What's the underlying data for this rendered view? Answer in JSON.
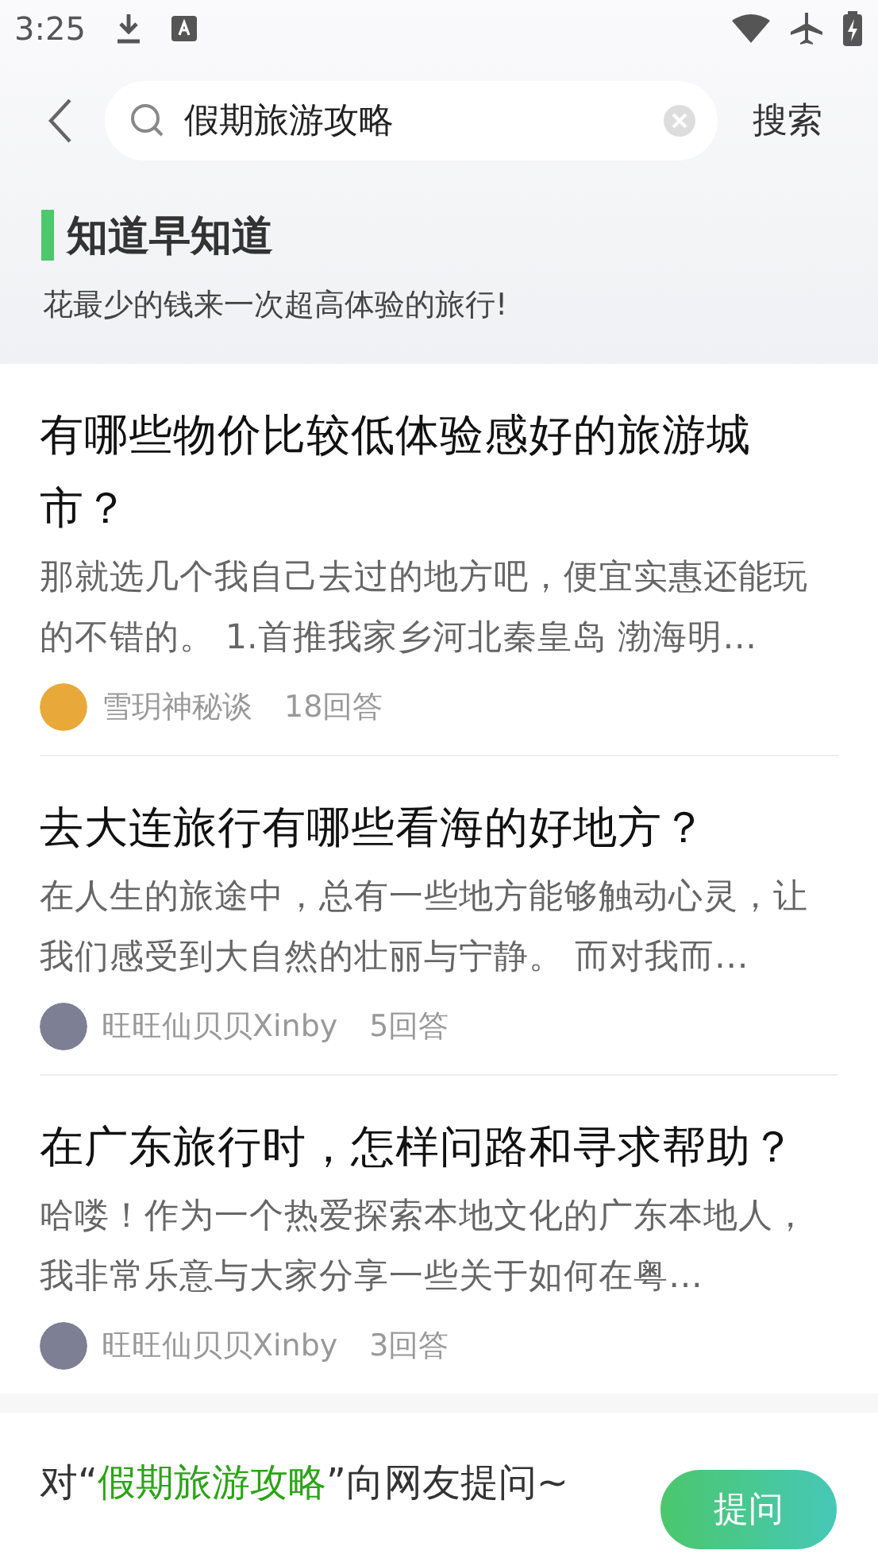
{
  "status_bar": {
    "time": "3:25"
  },
  "search": {
    "value": "假期旅游攻略",
    "action": "搜索"
  },
  "banner": {
    "title": "知道早知道",
    "subtitle": "花最少的钱来一次超高体验的旅行!"
  },
  "questions": [
    {
      "title": "有哪些物价比较低体验感好的旅游城市？",
      "excerpt": "那就选几个我自己去过的地方吧，便宜实惠还能玩的不错的。 1.首推我家乡河北秦皇岛 渤海明…",
      "author": "雪玥神秘谈",
      "answers": "18回答",
      "color": "#e8a93a"
    },
    {
      "title": "去大连旅行有哪些看海的好地方？",
      "excerpt": "在人生的旅途中，总有一些地方能够触动心灵，让我们感受到大自然的壮丽与宁静。 而对我而…",
      "author": "旺旺仙贝贝Xinby",
      "answers": "5回答",
      "color": "#7d7f95"
    },
    {
      "title": "在广东旅行时，怎样问路和寻求帮助？",
      "excerpt": "哈喽！作为一个热爱探索本地文化的广东本地人，我非常乐意与大家分享一些关于如何在粤…",
      "author": "旺旺仙贝贝Xinby",
      "answers": "3回答",
      "color": "#7d7f95"
    }
  ],
  "ask": {
    "prefix": "对“",
    "keyword": "假期旅游攻略",
    "suffix": "”向网友提问~",
    "button": "提问"
  }
}
